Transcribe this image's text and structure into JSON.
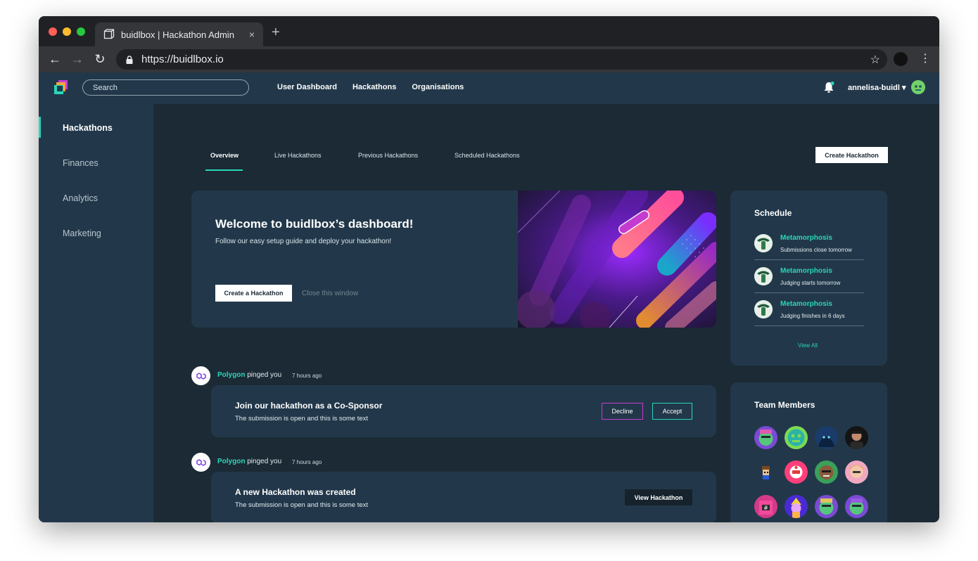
{
  "browser": {
    "tab_title": "buidlbox | Hackathon Admin",
    "tab_close": "×",
    "new_tab": "+",
    "url": "https://buidlbox.io",
    "traffic_lights": [
      "#ff5f57",
      "#febc2e",
      "#28c840"
    ]
  },
  "header": {
    "search_placeholder": "Search",
    "nav": [
      "User Dashboard",
      "Hackathons",
      "Organisations"
    ],
    "username": "annelisa-buidl ▾",
    "accent": "#2ad6b8"
  },
  "sidebar": {
    "items": [
      {
        "label": "Hackathons",
        "active": true
      },
      {
        "label": "Finances"
      },
      {
        "label": "Analytics"
      },
      {
        "label": "Marketing"
      }
    ]
  },
  "tabs": [
    "Overview",
    "Live Hackathons",
    "Previous Hackathons",
    "Scheduled Hackathons"
  ],
  "create_button": "Create Hackathon",
  "welcome": {
    "title": "Welcome to buidlbox’s dashboard!",
    "subtitle": "Follow our easy setup guide and deploy your hackathon!",
    "primary": "Create a Hackathon",
    "secondary": "Close this window"
  },
  "schedule": {
    "title": "Schedule",
    "items": [
      {
        "name": "Metamorphosis",
        "detail": "Submissions close tomorrow"
      },
      {
        "name": "Metamorphosis",
        "detail": "Judging starts tomorrow"
      },
      {
        "name": "Metamorphosis",
        "detail": "Judging finishes in 6 days"
      }
    ],
    "view_all": "View All"
  },
  "team": {
    "title": "Team Members",
    "member_count": 12
  },
  "feed": [
    {
      "sender": "Polygon",
      "action": " pinged you",
      "time": "7 hours ago",
      "title": "Join our hackathon as a Co-Sponsor",
      "body": "The submission is open and this is some text",
      "actions": [
        "Decline",
        "Accept"
      ]
    },
    {
      "sender": "Polygon",
      "action": " pinged you",
      "time": "7 hours ago",
      "title": "A new Hackathon was created",
      "body": "The submission is open and this is some text",
      "actions": [
        "View Hackathon"
      ]
    }
  ]
}
